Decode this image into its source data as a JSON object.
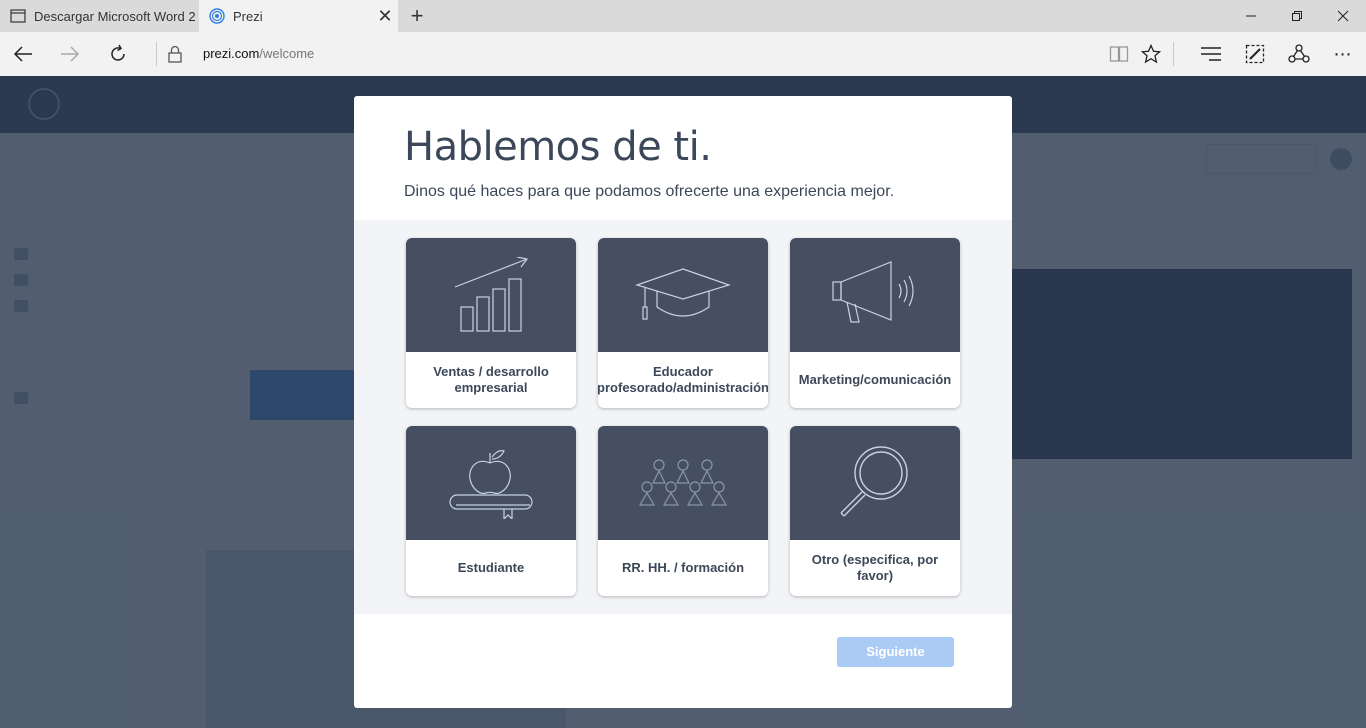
{
  "browser": {
    "tabs": [
      {
        "title": "Descargar Microsoft Word 2",
        "active": false,
        "icon": "page-icon"
      },
      {
        "title": "Prezi",
        "active": true,
        "icon": "prezi-icon"
      }
    ],
    "new_tab_symbol": "+",
    "url_host": "prezi.com",
    "url_path": "/welcome"
  },
  "modal": {
    "title": "Hablemos de ti.",
    "subtitle": "Dinos qué haces para que podamos ofrecerte una experiencia mejor.",
    "options": [
      {
        "label": "Ventas / desarrollo empresarial",
        "icon": "growth-chart-icon"
      },
      {
        "label": "Educador (profesorado/administración)",
        "icon": "graduation-cap-icon"
      },
      {
        "label": "Marketing/comunicación",
        "icon": "megaphone-icon"
      },
      {
        "label": "Estudiante",
        "icon": "apple-book-icon"
      },
      {
        "label": "RR. HH. / formación",
        "icon": "people-group-icon"
      },
      {
        "label": "Otro (especifica, por favor)",
        "icon": "magnifier-icon"
      }
    ],
    "next_label": "Siguiente",
    "next_enabled": false
  },
  "colors": {
    "overlay": "#2b3a4f",
    "tile_bg": "#454f61",
    "next_disabled": "#a9cbf4",
    "text": "#3c4859"
  }
}
